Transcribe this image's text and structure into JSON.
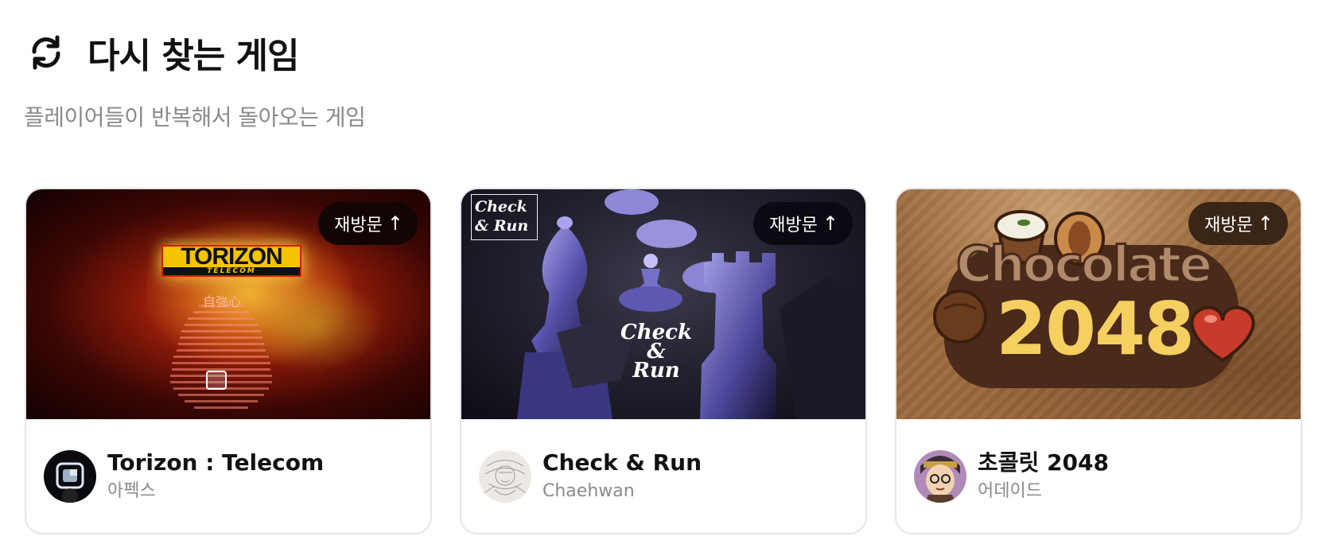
{
  "section": {
    "icon": "refresh-icon",
    "title": "다시 찾는 게임",
    "subtitle": "플레이어들이 반복해서 돌아오는 게임"
  },
  "cards": [
    {
      "badge": "재방문",
      "badge_arrow": "↑",
      "title": "Torizon : Telecom",
      "developer": "아펙스",
      "thumbnail": {
        "logo_text": "TORIZON",
        "logo_sub": "TELECOM",
        "overlay_text": "自強心"
      }
    },
    {
      "badge": "재방문",
      "badge_arrow": "↑",
      "title": "Check & Run",
      "developer": "Chaehwan",
      "thumbnail": {
        "logo_text": "Check & Run"
      }
    },
    {
      "badge": "재방문",
      "badge_arrow": "↑",
      "title": "초콜릿 2048",
      "developer": "어데이드",
      "thumbnail": {
        "logo_line1": "Chocolate",
        "logo_line2": "2048"
      }
    }
  ],
  "colors": {
    "badge_dark": "#140505",
    "badge_mid": "#0a0a12",
    "badge_brown": "#3a2616",
    "subtitle": "#8a8a8a",
    "card_border": "#e6e6e6"
  }
}
